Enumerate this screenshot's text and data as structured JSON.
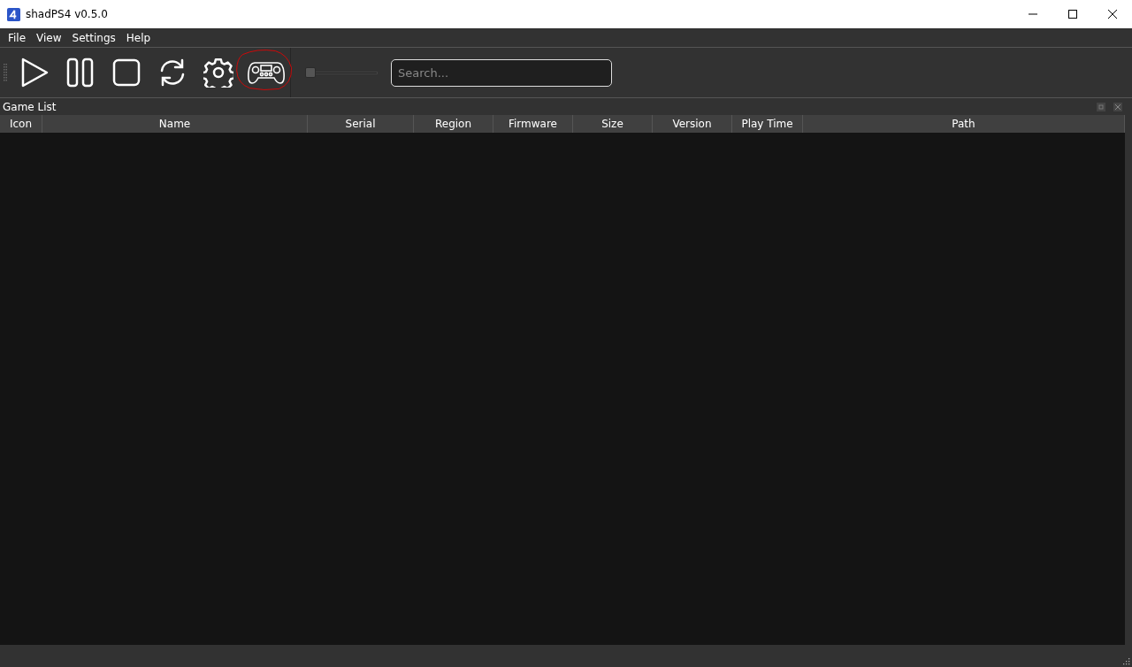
{
  "window": {
    "title": "shadPS4 v0.5.0"
  },
  "menu": [
    "File",
    "View",
    "Settings",
    "Help"
  ],
  "toolbar": {
    "buttons": [
      {
        "kind": "play"
      },
      {
        "kind": "pause"
      },
      {
        "kind": "stop"
      },
      {
        "kind": "refresh"
      },
      {
        "kind": "settings"
      },
      {
        "kind": "controller",
        "highlighted": true
      }
    ],
    "slider": {
      "level": 0.0
    },
    "search": {
      "placeholder": "Search..."
    }
  },
  "dock": {
    "title": "Game List"
  },
  "table": {
    "columns": [
      "Icon",
      "Name",
      "Serial",
      "Region",
      "Firmware",
      "Size",
      "Version",
      "Play Time",
      "Path"
    ]
  }
}
